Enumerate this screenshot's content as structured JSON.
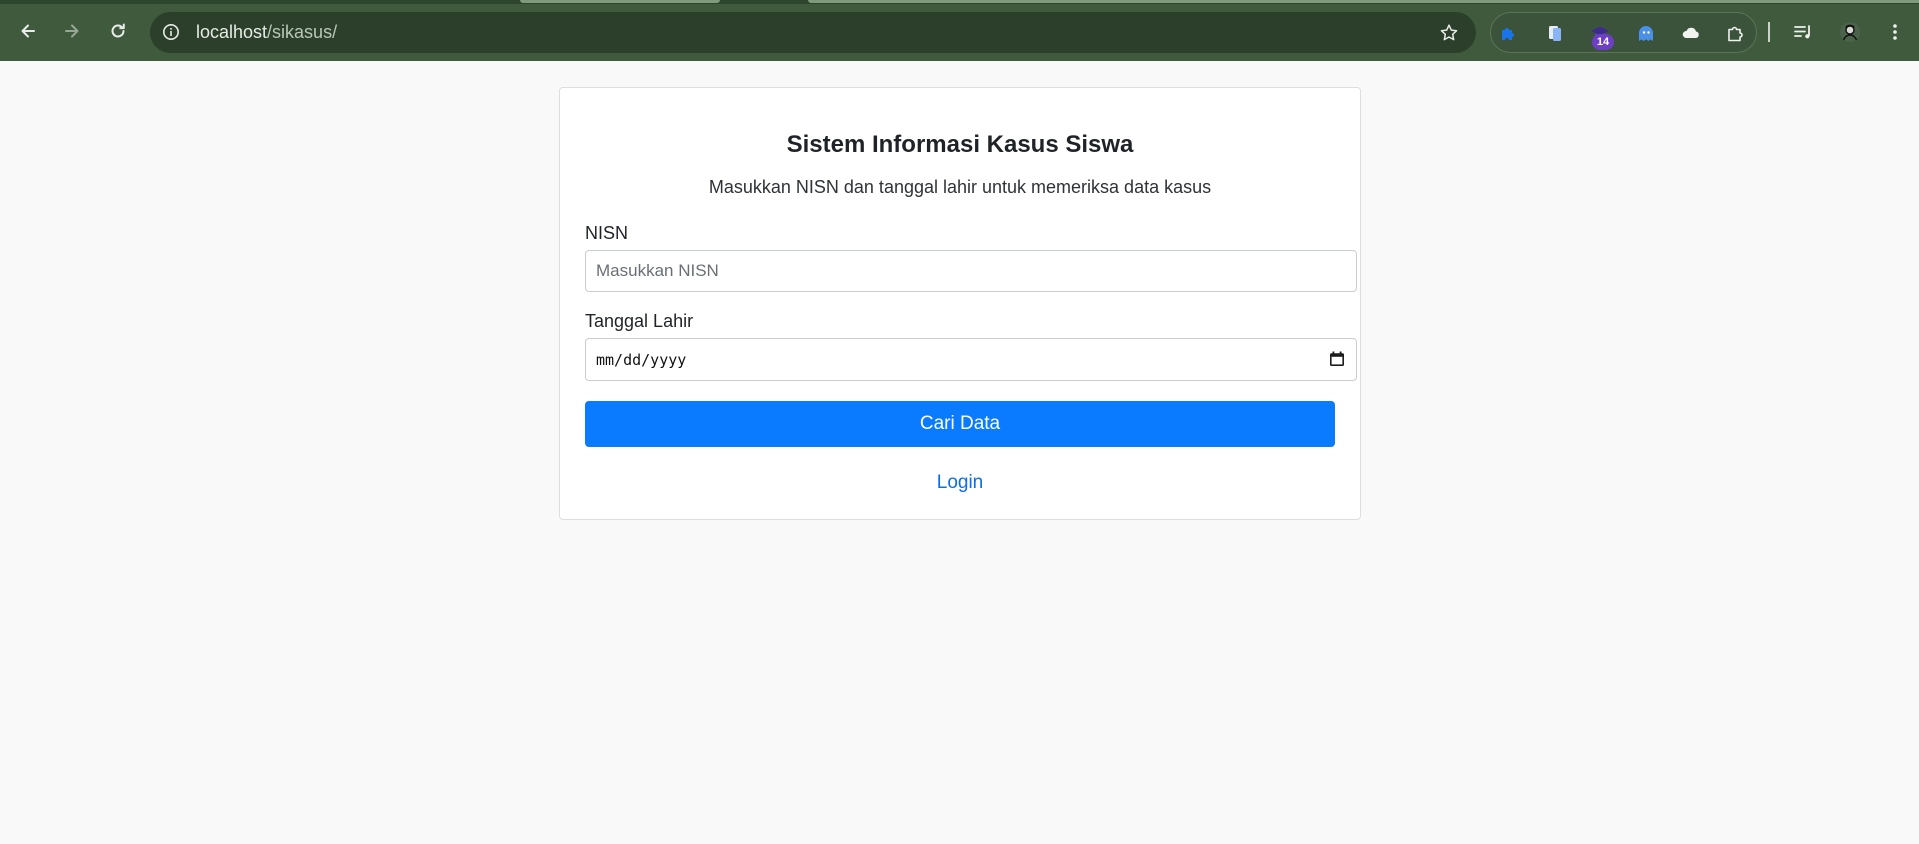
{
  "browser": {
    "url_host": "localhost",
    "url_path": "/sikasus/",
    "extension_badge": "14",
    "icons": {
      "back": "arrow-left-icon",
      "forward": "arrow-right-icon",
      "reload": "reload-icon",
      "site_info": "info-icon",
      "bookmark": "star-icon",
      "extensions": [
        "puzzle-extension-icon",
        "document-extension-icon",
        "graduation-cap-extension-icon",
        "ghost-extension-icon",
        "cloud-extension-icon",
        "extensions-puzzle-icon"
      ],
      "reading_list": "playlist-icon",
      "profile": "avatar-icon",
      "menu": "kebab-menu-icon"
    },
    "colors": {
      "frame": "#3f5a3d",
      "omnibox": "#2b3f2b",
      "badge": "#6d3fc2"
    }
  },
  "page": {
    "title": "Sistem Informasi Kasus Siswa",
    "subtitle": "Masukkan NISN dan tanggal lahir untuk memeriksa data kasus",
    "form": {
      "nisn_label": "NISN",
      "nisn_placeholder": "Masukkan NISN",
      "nisn_value": "",
      "dob_label": "Tanggal Lahir",
      "dob_placeholder": "mm/dd/yyyy",
      "submit_label": "Cari Data"
    },
    "login_link": "Login",
    "colors": {
      "primary": "#0a7bff",
      "link": "#0a6fe8"
    }
  }
}
